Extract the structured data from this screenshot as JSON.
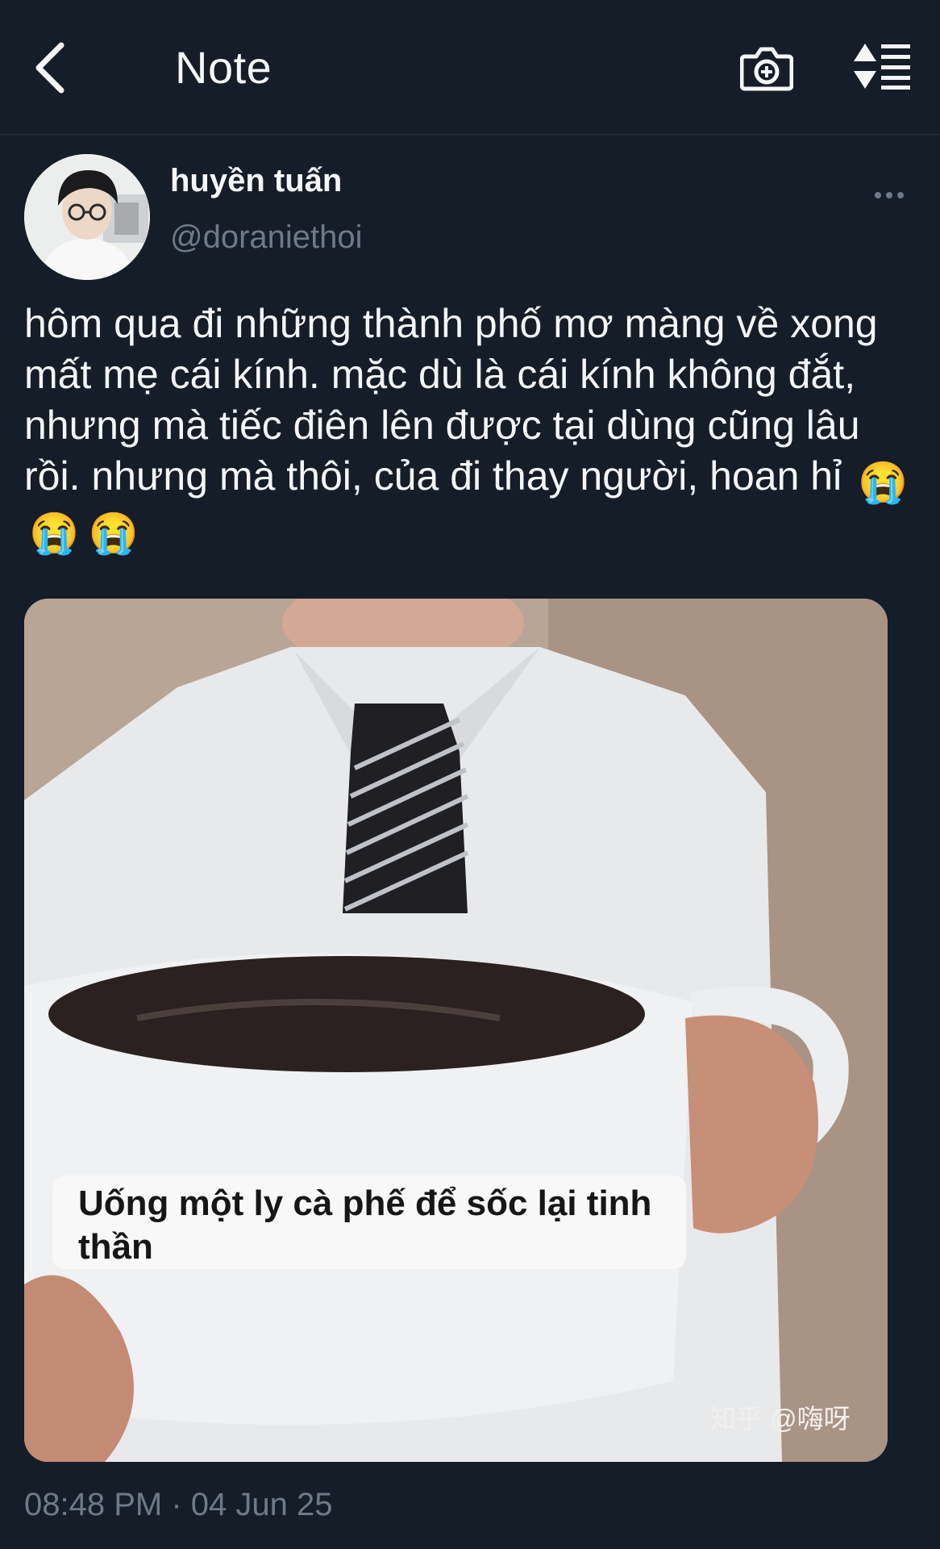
{
  "header": {
    "title": "Note"
  },
  "post": {
    "author_name": "huyền tuấn",
    "author_handle": "@doraniethoi",
    "text": "hôm qua đi những thành phố mơ màng về xong mất mẹ cái kính. mặc dù là cái kính không đắt, nhưng mà tiếc điên lên được tại dùng cũng lâu rồi. nhưng mà thôi, của đi thay người, hoan hỉ",
    "emojis": [
      "😭",
      "😭",
      "😭"
    ],
    "image": {
      "caption": "Uống một ly cà phế để sốc lại tinh thần",
      "watermark": "知乎 @嗨呀"
    },
    "timestamp": "08:48 PM · 04 Jun 25"
  },
  "colors": {
    "background": "#151d28",
    "muted_text": "#6d7a88",
    "primary_text": "#f5f6f8"
  },
  "icons": {
    "back": "chevron-left-icon",
    "camera": "camera-add-icon",
    "sort": "sort-list-icon",
    "more": "more-horizontal-icon"
  }
}
